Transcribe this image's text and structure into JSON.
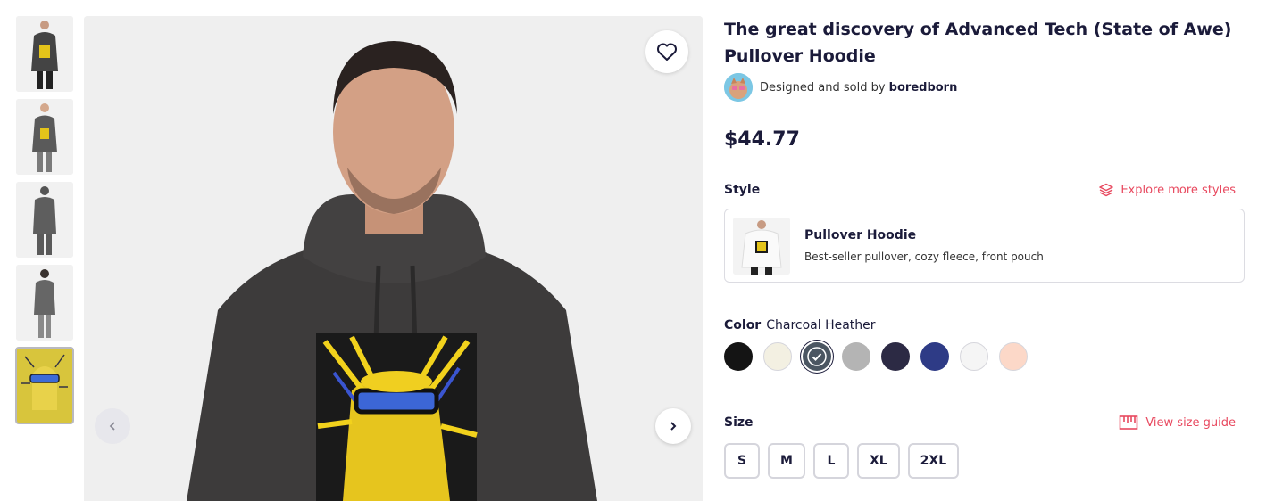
{
  "product": {
    "title": "The great discovery of Advanced Tech (State of Awe) Pullover Hoodie",
    "seller_prefix": "Designed and sold by",
    "seller_name": "boredborn",
    "price": "$44.77"
  },
  "gallery": {
    "thumbnails": [
      "model-front",
      "model-front-female",
      "model-back",
      "model-back-female",
      "artwork"
    ],
    "selected_index": 4
  },
  "style": {
    "label": "Style",
    "explore_link": "Explore more styles",
    "card_name": "Pullover Hoodie",
    "card_desc": "Best-seller pullover, cozy fleece, front pouch"
  },
  "color": {
    "label": "Color",
    "selected": "Charcoal Heather",
    "swatches": [
      "#141414",
      "#f3f0e2",
      "#4b5662",
      "#b4b4b4",
      "#2c2a44",
      "#2e3b86",
      "#f5f5f5",
      "#fcd8c8"
    ],
    "selected_index": 2
  },
  "size": {
    "label": "Size",
    "guide_link": "View size guide",
    "options": [
      "S",
      "M",
      "L",
      "XL",
      "2XL"
    ]
  },
  "icons": {
    "favorite": "heart-icon",
    "prev": "chevron-left-icon",
    "next": "chevron-right-icon",
    "styles": "layers-icon",
    "size_guide": "ruler-icon",
    "check": "check-icon"
  },
  "colors": {
    "accent": "#e8495f",
    "text": "#1b1b3a",
    "border": "#d5d5dc"
  }
}
